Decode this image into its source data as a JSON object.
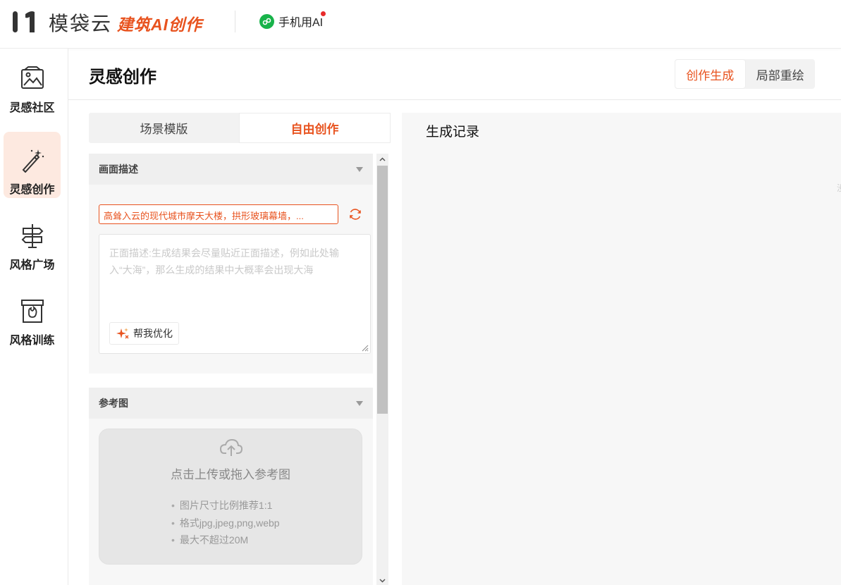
{
  "header": {
    "brand": "模袋云",
    "product": "建筑AI创作",
    "mini_app_label": "手机用AI"
  },
  "sidebar": {
    "items": [
      {
        "label": "灵感社区",
        "icon": "image-icon"
      },
      {
        "label": "灵感创作",
        "icon": "magic-wand-icon"
      },
      {
        "label": "风格广场",
        "icon": "signpost-icon"
      },
      {
        "label": "风格训练",
        "icon": "archive-box-icon"
      }
    ]
  },
  "page": {
    "title": "灵感创作",
    "modes": [
      "创作生成",
      "局部重绘"
    ],
    "active_mode": "创作生成",
    "tabs": [
      "场景模版",
      "自由创作"
    ],
    "active_tab": "自由创作"
  },
  "description": {
    "header": "画面描述",
    "prompt_suggestion": "高耸入云的现代城市摩天大楼，拱形玻璃幕墙，...",
    "placeholder": "正面描述:生成结果会尽量贴近正面描述，例如此处输入“大海”，那么生成的结果中大概率会出现大海",
    "optimize_label": "帮我优化"
  },
  "reference": {
    "header": "参考图",
    "upload_text": "点击上传或拖入参考图",
    "hints": [
      "图片尺寸比例推荐1:1",
      "格式jpg,jpeg,png,webp",
      "最大不超过20M"
    ]
  },
  "records": {
    "title": "生成记录",
    "edge_text": "没"
  },
  "colors": {
    "accent": "#e8531f",
    "active_side_bg": "#fde9e0"
  }
}
